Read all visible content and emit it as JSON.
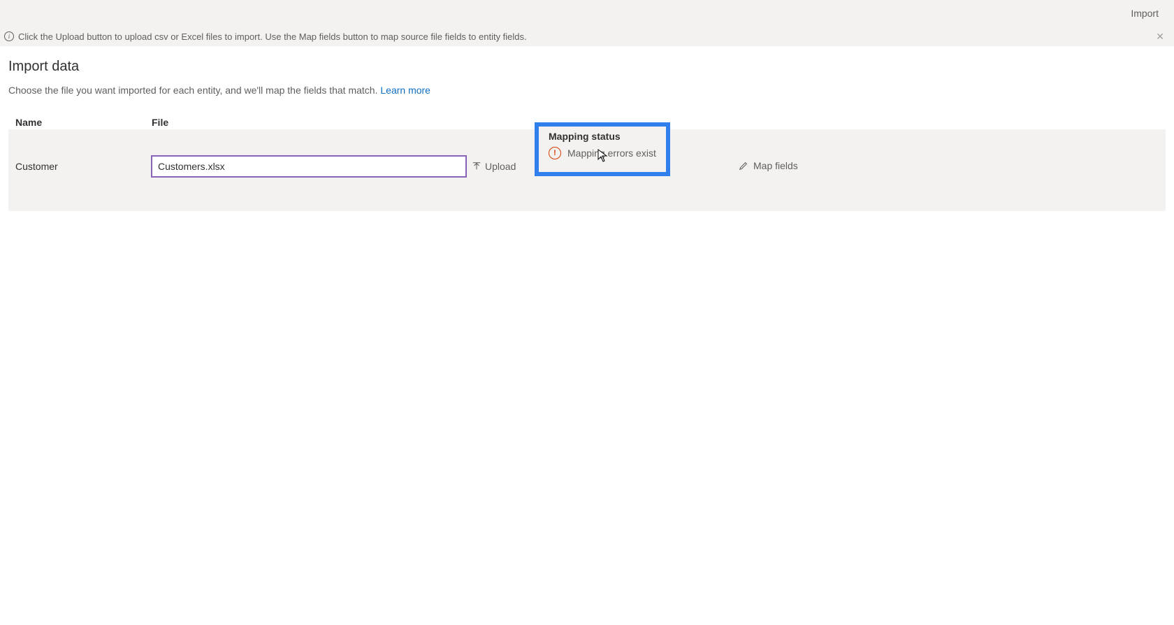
{
  "topbar": {
    "import_label": "Import"
  },
  "info_bar": {
    "text": "Click the Upload button to upload csv or Excel files to import. Use the Map fields button to map source file fields to entity fields."
  },
  "page": {
    "title": "Import data",
    "subtitle_text": "Choose the file you want imported for each entity, and we'll map the fields that match. ",
    "learn_more": "Learn more"
  },
  "grid": {
    "headers": {
      "name": "Name",
      "file": "File",
      "status": "Mapping status"
    },
    "row": {
      "entity_name": "Customer",
      "file_value": "Customers.xlsx",
      "upload_label": "Upload",
      "status_text": "Mapping errors exist",
      "map_fields_label": "Map fields"
    }
  }
}
